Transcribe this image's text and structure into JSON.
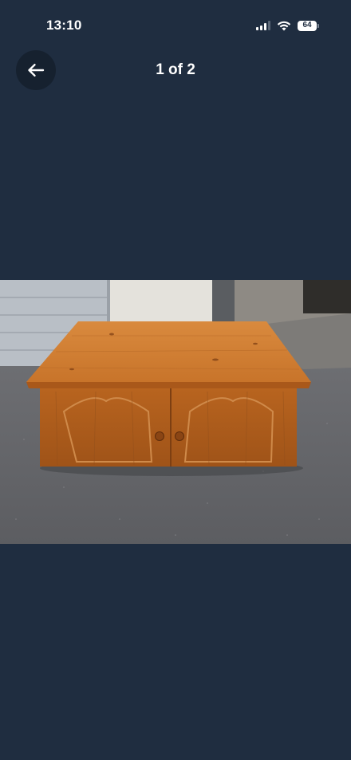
{
  "status_bar": {
    "time": "13:10",
    "battery_level": "64",
    "signal_icon": "cellular-signal-icon",
    "wifi_icon": "wifi-icon"
  },
  "header": {
    "back_icon": "arrow-left-icon",
    "page_counter": "1 of 2"
  },
  "gallery": {
    "current_index": 1,
    "total": 2,
    "image_subject": "pine-storage-chest-photo"
  },
  "colors": {
    "background": "#1f2d40",
    "back_button_bg": "#16212f",
    "text": "#ffffff"
  }
}
